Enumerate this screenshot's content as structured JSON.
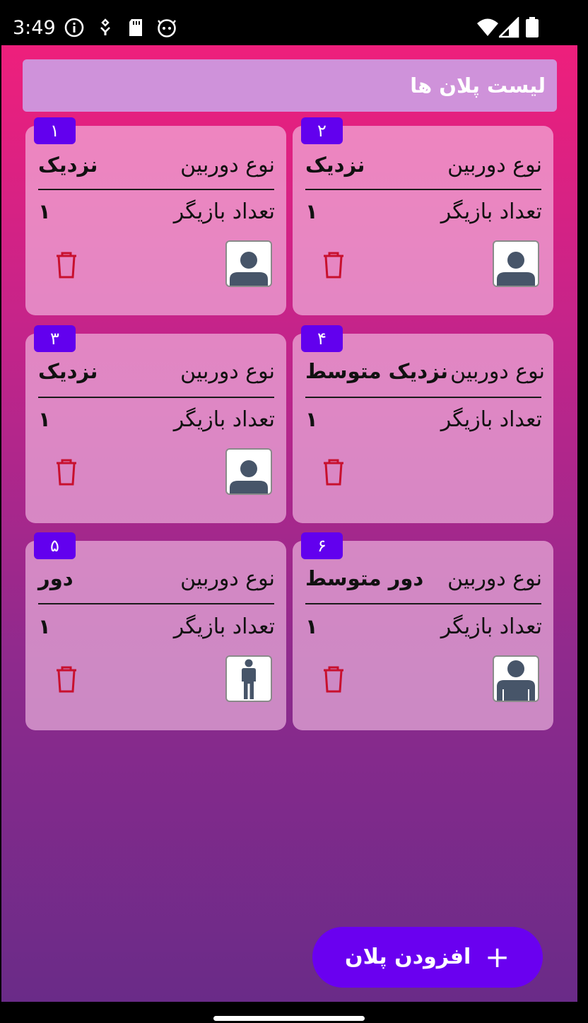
{
  "status_bar": {
    "time": "3:49",
    "left_icons": [
      "info-icon",
      "usb-debug-icon",
      "sd-card-icon",
      "android-face-icon"
    ],
    "right_icons": [
      "wifi-icon",
      "signal-icon",
      "battery-icon"
    ]
  },
  "header": {
    "title": "لیست پلان ها"
  },
  "labels": {
    "camera_type": "نوع دوربین",
    "player_count": "تعداد بازیگر"
  },
  "plans": [
    {
      "number": "۱",
      "camera_type_value": "نزدیک",
      "player_count_value": "۱",
      "thumbnail": "close-up-person-icon",
      "trash_icon": "trash-icon"
    },
    {
      "number": "۲",
      "camera_type_value": "نزدیک",
      "player_count_value": "۱",
      "thumbnail": "close-up-person-icon",
      "trash_icon": "trash-icon"
    },
    {
      "number": "۳",
      "camera_type_value": "نزدیک",
      "player_count_value": "۱",
      "thumbnail": "close-up-person-icon",
      "trash_icon": "trash-icon"
    },
    {
      "number": "۴",
      "camera_type_value": "نزدیک متوسط",
      "player_count_value": "۱",
      "thumbnail": "",
      "trash_icon": "trash-icon"
    },
    {
      "number": "۵",
      "camera_type_value": "دور",
      "player_count_value": "۱",
      "thumbnail": "full-body-person-icon",
      "trash_icon": "trash-icon"
    },
    {
      "number": "۶",
      "camera_type_value": "دور متوسط",
      "player_count_value": "۱",
      "thumbnail": "medium-shot-person-icon",
      "trash_icon": "trash-icon"
    }
  ],
  "fab": {
    "label": "افزودن پلان",
    "icon": "plus-icon",
    "color": "#6a00f0"
  },
  "colors": {
    "badge": "#6200ee",
    "trash": "#c8102e",
    "avatar": "#475569",
    "header_bg": "#cf92da"
  }
}
